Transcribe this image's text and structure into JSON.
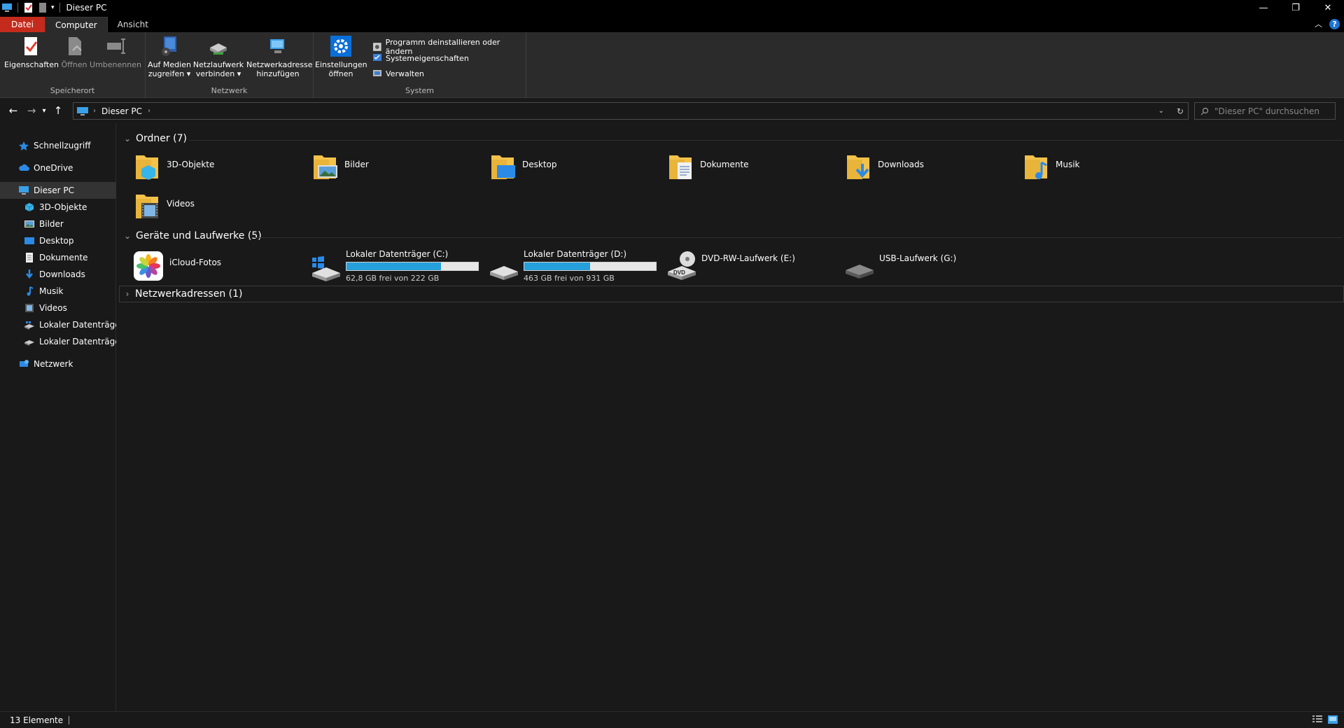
{
  "window": {
    "title": "Dieser PC",
    "minimize": "—",
    "maximize": "❐",
    "close": "✕"
  },
  "tabs": {
    "file": "Datei",
    "computer": "Computer",
    "view": "Ansicht",
    "help": "?"
  },
  "ribbon": {
    "storage": {
      "label": "Speicherort",
      "properties": "Eigenschaften",
      "open": "Öffnen",
      "rename": "Umbenennen"
    },
    "network": {
      "label": "Netzwerk",
      "media": [
        "Auf Medien",
        "zugreifen ▾"
      ],
      "map_drive": [
        "Netzlaufwerk",
        "verbinden ▾"
      ],
      "add_location": [
        "Netzwerkadresse",
        "hinzufügen"
      ]
    },
    "system": {
      "label": "System",
      "settings": [
        "Einstellungen",
        "öffnen"
      ],
      "uninstall": "Programm deinstallieren oder ändern",
      "sysprops": "Systemeigenschaften",
      "manage": "Verwalten"
    }
  },
  "address": {
    "path": "Dieser PC",
    "search_placeholder": "\"Dieser PC\" durchsuchen"
  },
  "sidebar": {
    "quick": "Schnellzugriff",
    "onedrive": "OneDrive",
    "thispc": "Dieser PC",
    "items": [
      "3D-Objekte",
      "Bilder",
      "Desktop",
      "Dokumente",
      "Downloads",
      "Musik",
      "Videos",
      "Lokaler Datenträger (C:)",
      "Lokaler Datenträger (D:)"
    ],
    "network": "Netzwerk"
  },
  "folders": {
    "header": "Ordner (7)",
    "items": [
      "3D-Objekte",
      "Bilder",
      "Desktop",
      "Dokumente",
      "Downloads",
      "Musik",
      "Videos"
    ]
  },
  "devices": {
    "header": "Geräte und Laufwerke (5)",
    "icloud": "iCloud-Fotos",
    "c": {
      "name": "Lokaler Datenträger (C:)",
      "free": "62,8 GB frei von 222 GB",
      "used_fraction": 0.72
    },
    "d": {
      "name": "Lokaler Datenträger (D:)",
      "free": "463 GB frei von 931 GB",
      "used_fraction": 0.5
    },
    "dvd": "DVD-RW-Laufwerk (E:)",
    "dvd_badge": "DVD",
    "usb": "USB-Laufwerk (G:)"
  },
  "netlocations": {
    "header": "Netzwerkadressen (1)"
  },
  "status": {
    "count": "13 Elemente"
  }
}
